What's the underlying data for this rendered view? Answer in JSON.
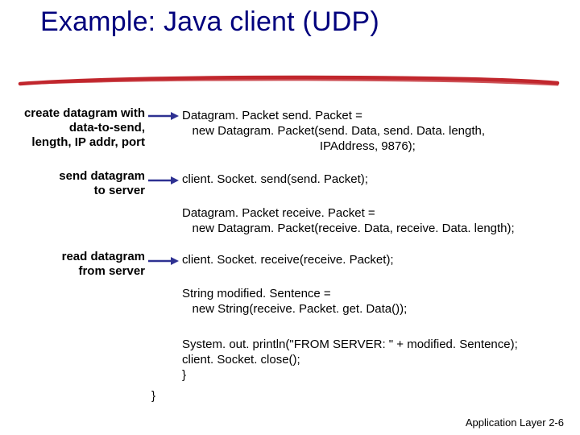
{
  "title": "Example: Java client (UDP)",
  "annotations": {
    "a1": "create datagram with\ndata-to-send,\nlength, IP addr, port",
    "a2": "send datagram\nto server",
    "a3": "read datagram\nfrom server"
  },
  "code": {
    "c1": "Datagram. Packet send. Packet =\n   new Datagram. Packet(send. Data, send. Data. length,\n                                         IPAddress, 9876);",
    "c2": "client. Socket. send(send. Packet);",
    "c3": "Datagram. Packet receive. Packet =\n   new Datagram. Packet(receive. Data, receive. Data. length);",
    "c4": "client. Socket. receive(receive. Packet);",
    "c5": "String modified. Sentence =\n   new String(receive. Packet. get. Data());",
    "c6": "System. out. println(\"FROM SERVER: \" + modified. Sentence);\nclient. Socket. close();\n}",
    "c7": "}"
  },
  "footer": {
    "label": "Application Layer",
    "page": "2-6"
  },
  "colors": {
    "title": "#00007d",
    "underline": "#c1272d",
    "arrow": "#2e3192"
  }
}
